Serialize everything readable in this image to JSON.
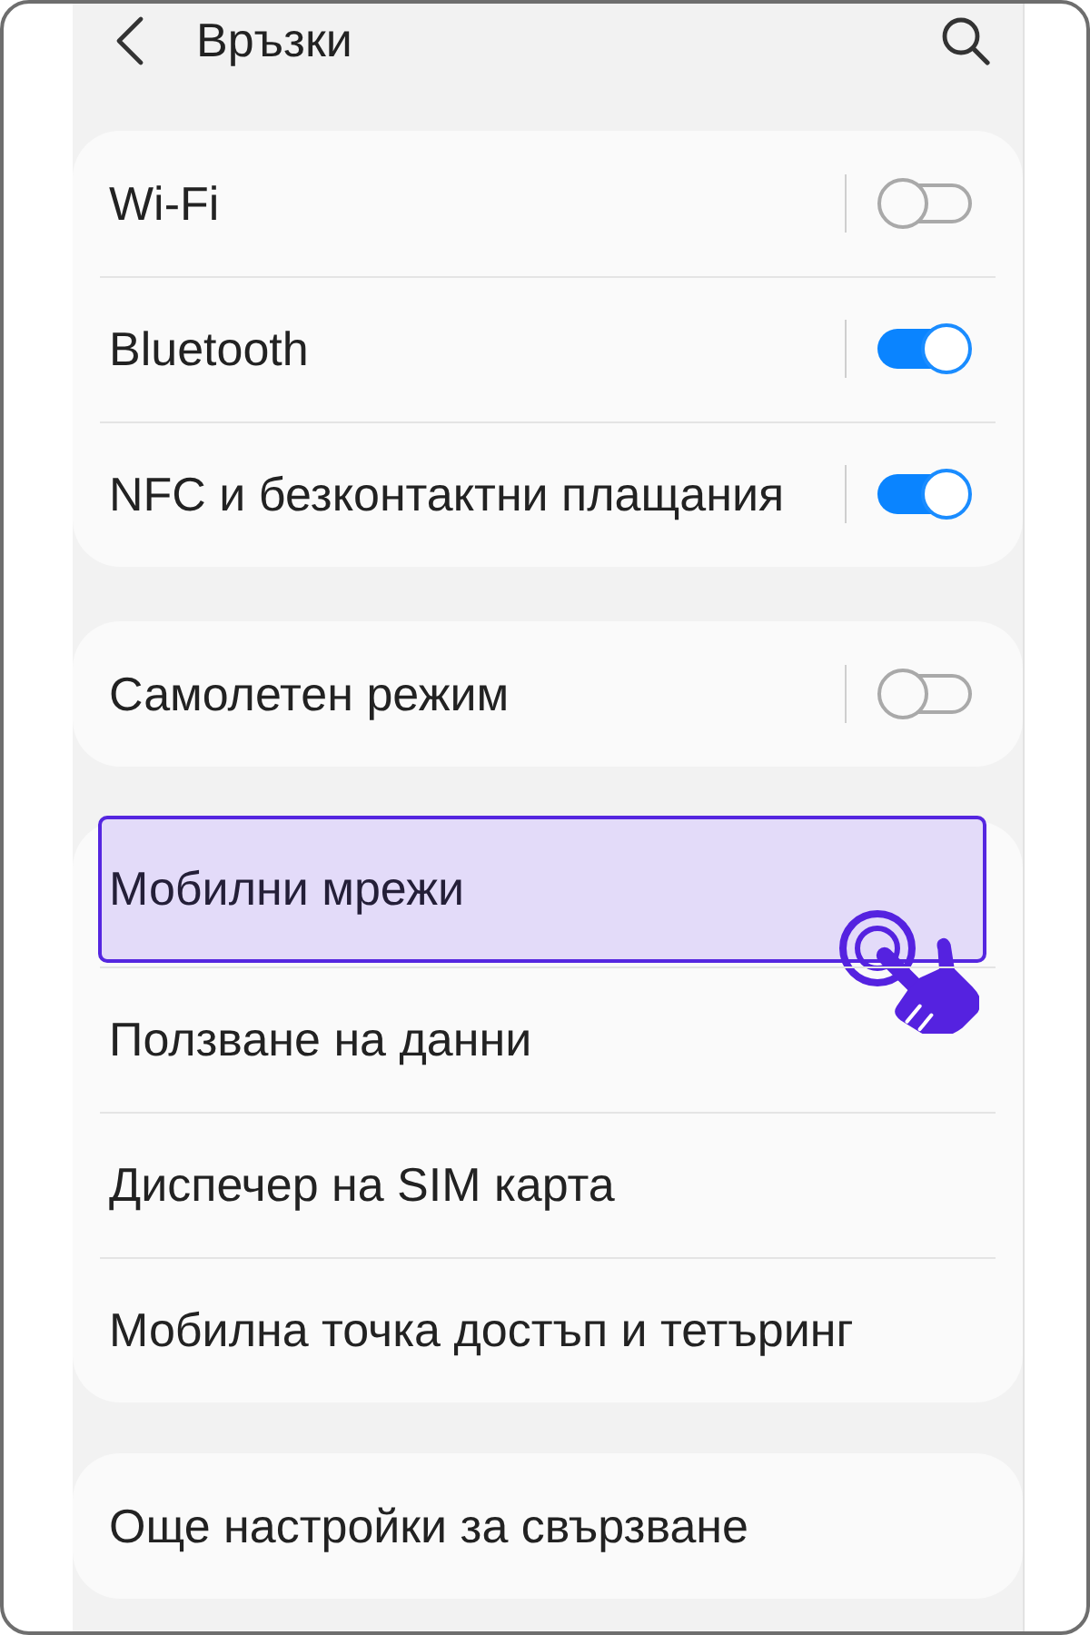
{
  "header": {
    "title": "Връзки"
  },
  "groups": [
    {
      "items": [
        {
          "kind": "toggle",
          "label": "Wi-Fi",
          "on": false,
          "highlighted": false
        },
        {
          "kind": "toggle",
          "label": "Bluetooth",
          "on": true,
          "highlighted": false
        },
        {
          "kind": "toggle",
          "label": "NFC и безконтактни плащания",
          "on": true,
          "highlighted": false
        }
      ]
    },
    {
      "items": [
        {
          "kind": "toggle",
          "label": "Самолетен режим",
          "on": false,
          "highlighted": false
        }
      ]
    },
    {
      "items": [
        {
          "kind": "link",
          "label": "Мобилни мрежи",
          "highlighted": true
        },
        {
          "kind": "link",
          "label": "Ползване на данни",
          "highlighted": false
        },
        {
          "kind": "link",
          "label": "Диспечер на SIM карта",
          "highlighted": false
        },
        {
          "kind": "link",
          "label": "Мобилна точка достъп и тетъринг",
          "highlighted": false
        }
      ]
    },
    {
      "items": [
        {
          "kind": "link",
          "label": "Още настройки за свързване",
          "highlighted": false
        }
      ]
    }
  ]
}
